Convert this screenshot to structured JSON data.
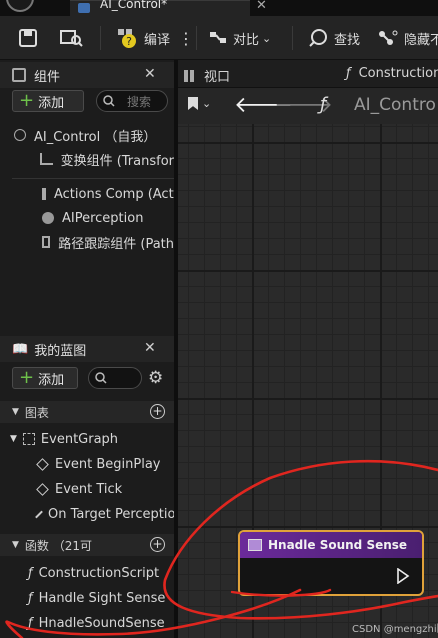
{
  "tab": {
    "title": "AI_Control*"
  },
  "toolbar": {
    "compile_label": "编译",
    "diff_label": "对比",
    "find_label": "查找",
    "hide_label": "隐藏不"
  },
  "components": {
    "title": "组件",
    "add_label": "添加",
    "search_placeholder": "搜索",
    "root_item": "AI_Control （自我）",
    "items": [
      "变换组件 (Transfor",
      "Actions Comp (Acti",
      "AIPerception",
      "路径跟踪组件 (Path"
    ]
  },
  "graph_editor": {
    "viewport_tab": "视口",
    "construction_tab": "Construction",
    "breadcrumb": "AI_Contro"
  },
  "my_blueprint": {
    "title": "我的蓝图",
    "add_label": "添加",
    "search_placeholder": "",
    "graphs_label": "图表",
    "event_graph": "EventGraph",
    "events": [
      "Event BeginPlay",
      "Event Tick",
      "On Target Perceptio"
    ],
    "functions_label": "函数 （21可",
    "functions": [
      "ConstructionScript",
      "Handle Sight Sense",
      "HnadleSoundSense"
    ]
  },
  "node": {
    "title": "Hnadle Sound Sense"
  },
  "watermark": "CSDN @mengzhi阿"
}
